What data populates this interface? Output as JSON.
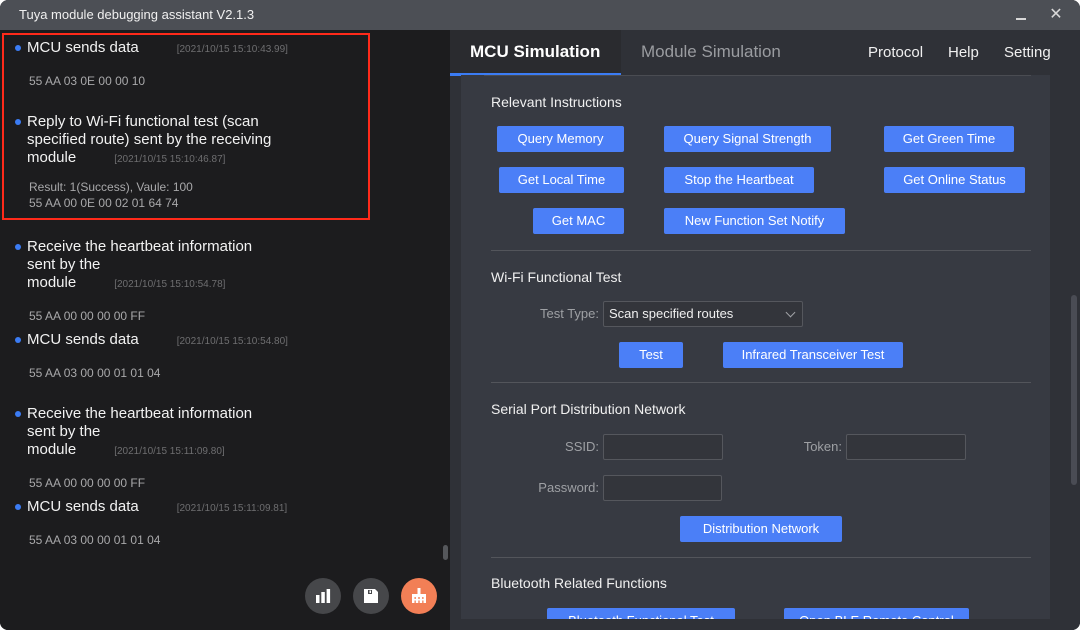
{
  "window": {
    "title": "Tuya module debugging assistant V2.1.3",
    "minimize_label": "–",
    "close_label": "✕"
  },
  "log": {
    "entries": [
      {
        "title": "MCU sends data",
        "time": "[2021/10/15 15:10:43.99]",
        "lines": [
          "55 AA 03 0E 00 00 10"
        ]
      },
      {
        "title": "Reply to Wi-Fi functional test (scan specified route) sent by the receiving module",
        "time": "[2021/10/15 15:10:46.87]",
        "lines": [
          "Result: 1(Success), Vaule: 100",
          "55 AA 00 0E 00 02 01 64 74"
        ]
      },
      {
        "title": "Receive the heartbeat information sent by the module",
        "time": "[2021/10/15 15:10:54.78]",
        "lines": [
          "55 AA 00 00 00 00 FF"
        ]
      },
      {
        "title": "MCU sends data",
        "time": "[2021/10/15 15:10:54.80]",
        "lines": [
          "55 AA 03 00 00 01 01 04"
        ]
      },
      {
        "title": "Receive the heartbeat information sent by the module",
        "time": "[2021/10/15 15:11:09.80]",
        "lines": [
          "55 AA 00 00 00 00 FF"
        ]
      },
      {
        "title": "MCU sends data",
        "time": "[2021/10/15 15:11:09.81]",
        "lines": [
          "55 AA 03 00 00 01 01 04"
        ]
      }
    ],
    "bullet_color": "#3b7cf4",
    "highlight_color": "#ff2a1a",
    "actions": [
      {
        "icon": "bar-chart-icon"
      },
      {
        "icon": "save-icon"
      },
      {
        "icon": "clear-brush-icon",
        "color": "#f27f56"
      }
    ]
  },
  "tabs": [
    {
      "label": "MCU Simulation",
      "active": true
    },
    {
      "label": "Module Simulation",
      "active": false
    }
  ],
  "menu": [
    "Protocol",
    "Help",
    "Setting"
  ],
  "sections": {
    "relevant": {
      "title": "Relevant Instructions",
      "buttons": [
        "Query Memory",
        "Query Signal Strength",
        "Get Green Time",
        "Get Local Time",
        "Stop the Heartbeat",
        "Get Online Status",
        "Get MAC",
        "New Function Set Notify"
      ]
    },
    "wifi": {
      "title": "Wi-Fi Functional Test",
      "test_type_label": "Test Type:",
      "test_type_value": "Scan specified routes",
      "buttons": [
        "Test",
        "Infrared Transceiver Test"
      ]
    },
    "serial": {
      "title": "Serial Port Distribution Network",
      "ssid_label": "SSID:",
      "ssid_value": "",
      "token_label": "Token:",
      "token_value": "",
      "password_label": "Password:",
      "password_value": "",
      "button": "Distribution Network"
    },
    "bluetooth": {
      "title": "Bluetooth Related Functions",
      "buttons": [
        "Bluetooth Functional Test",
        "Open BLE Remote Control"
      ]
    }
  },
  "accent_color": "#4b7ff7"
}
